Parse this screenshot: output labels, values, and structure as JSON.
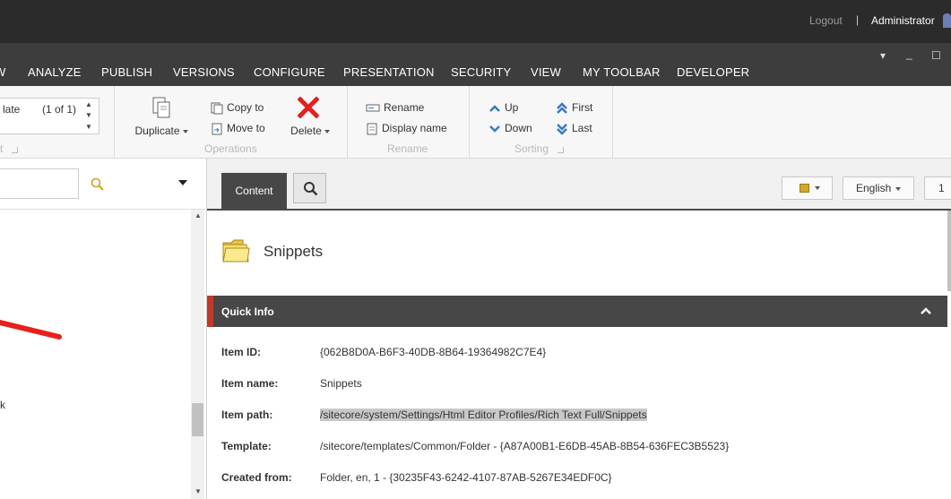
{
  "topbar": {
    "logout": "Logout",
    "separator": "|",
    "user": "Administrator"
  },
  "tabs": [
    "W",
    "ANALYZE",
    "PUBLISH",
    "VERSIONS",
    "CONFIGURE",
    "PRESENTATION",
    "SECURITY",
    "VIEW",
    "MY TOOLBAR",
    "DEVELOPER"
  ],
  "window_controls": {
    "dropdown": "▾",
    "minimize": "_",
    "maximize": "☐"
  },
  "ribbon": {
    "version": {
      "selector_text": "late",
      "count": "(1 of 1)",
      "chunk_title": "t"
    },
    "operations": {
      "title": "Operations",
      "duplicate": "Duplicate",
      "copy_to": "Copy to",
      "move_to": "Move to",
      "delete": "Delete"
    },
    "rename": {
      "title": "Rename",
      "rename": "Rename",
      "display_name": "Display name"
    },
    "sorting": {
      "title": "Sorting",
      "up": "Up",
      "down": "Down",
      "first": "First",
      "last": "Last"
    }
  },
  "left": {
    "tree_fragment": "k"
  },
  "content": {
    "tab_content": "Content",
    "language": "English",
    "version_btn": "1",
    "item_title": "Snippets",
    "quick_info": {
      "label": "Quick Info",
      "rows": [
        {
          "key": "Item ID:",
          "value": "{062B8D0A-B6F3-40DB-8B64-19364982C7E4}"
        },
        {
          "key": "Item name:",
          "value": "Snippets"
        },
        {
          "key": "Item path:",
          "value": "/sitecore/system/Settings/Html Editor Profiles/Rich Text Full/Snippets"
        },
        {
          "key": "Template:",
          "value": "/sitecore/templates/Common/Folder - {A87A00B1-E6DB-45AB-8B54-636FEC3B5523}"
        },
        {
          "key": "Created from:",
          "value": "Folder, en, 1 - {30235F43-6242-4107-87AB-5267E34EDF0C}"
        }
      ]
    }
  },
  "colors": {
    "accent_red": "#c0392b",
    "dark_bar": "#474747",
    "icon_blue": "#3a78c3"
  }
}
